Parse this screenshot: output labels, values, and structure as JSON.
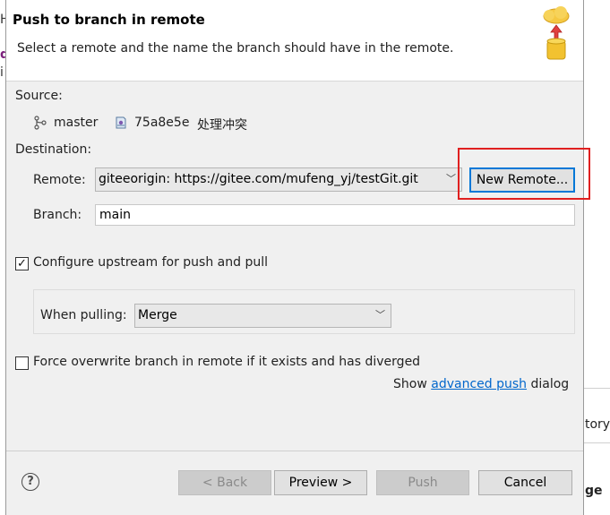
{
  "background": {
    "left_glyphs": [
      "H",
      "d",
      "i"
    ],
    "right_text_1": "tory",
    "right_text_2": "ge"
  },
  "dialog": {
    "title": "Push to branch in remote",
    "description": "Select a remote and the name the branch should have in the remote.",
    "source_label": "Source:",
    "source_branch": "master",
    "source_commit_id": "75a8e5e",
    "source_commit_message": "处理冲突",
    "destination_label": "Destination:",
    "remote_label": "Remote:",
    "remote_value": "giteeorigin: https://gitee.com/mufeng_yj/testGit.git",
    "new_remote_label": "New Remote...",
    "branch_label": "Branch:",
    "branch_value": "main",
    "configure_upstream_label": "Configure upstream for push and pull",
    "configure_upstream_checked": true,
    "when_pulling_label": "When pulling:",
    "when_pulling_value": "Merge",
    "force_overwrite_label": "Force overwrite branch in remote if it exists and has diverged",
    "force_overwrite_checked": false,
    "show_prefix": "Show",
    "advanced_push_link": "advanced push",
    "dialog_suffix": "dialog",
    "buttons": {
      "back": "< Back",
      "preview": "Preview >",
      "push": "Push",
      "cancel": "Cancel"
    }
  },
  "colors": {
    "link": "#0066cc",
    "highlight": "#e02020",
    "primary_border": "#0078d7"
  },
  "icons": {
    "branch": "git-branch-icon",
    "commit": "git-commit-icon",
    "wizard": "cloud-push-icon",
    "help": "help-icon",
    "dropdown": "chevron-down-icon"
  }
}
